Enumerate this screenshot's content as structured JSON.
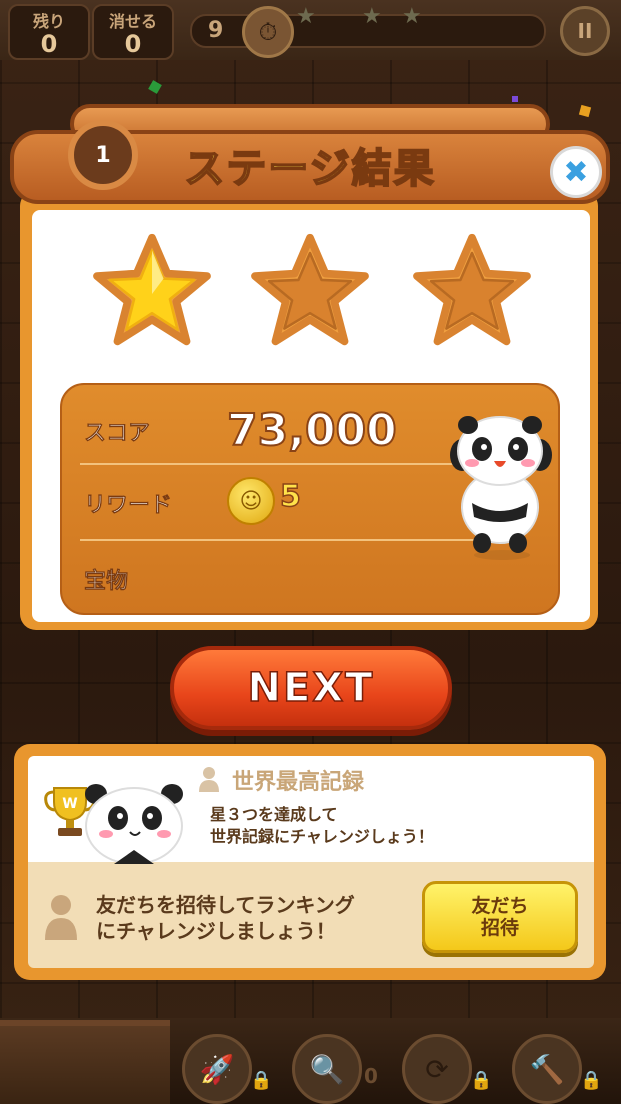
{
  "hud": {
    "remaining_label": "残り",
    "remaining_value": "0",
    "clearable_label": "消せる",
    "clearable_value": "0",
    "moves_value": "9"
  },
  "result": {
    "level": "1",
    "title": "ステージ結果",
    "stars_earned": 1,
    "stars_total": 3,
    "score_label": "スコア",
    "score_value": "73,000",
    "reward_label": "リワード",
    "reward_value": "5",
    "treasure_label": "宝物",
    "next_label": "NEXT"
  },
  "record": {
    "title": "世界最高記録",
    "desc_line1": "星３つを達成して",
    "desc_line2": "世界記録にチャレンジしょう！",
    "invite_line1": "友だちを招待してランキング",
    "invite_line2": "にチャレンジしましょう！",
    "invite_button_line1": "友だち",
    "invite_button_line2": "招待"
  },
  "toolbar": {
    "item_count": "0"
  },
  "colors": {
    "panel": "#e8962e",
    "next_button": "#e8451a",
    "invite_button": "#f4c81a",
    "star_gold": "#ffd21a"
  }
}
